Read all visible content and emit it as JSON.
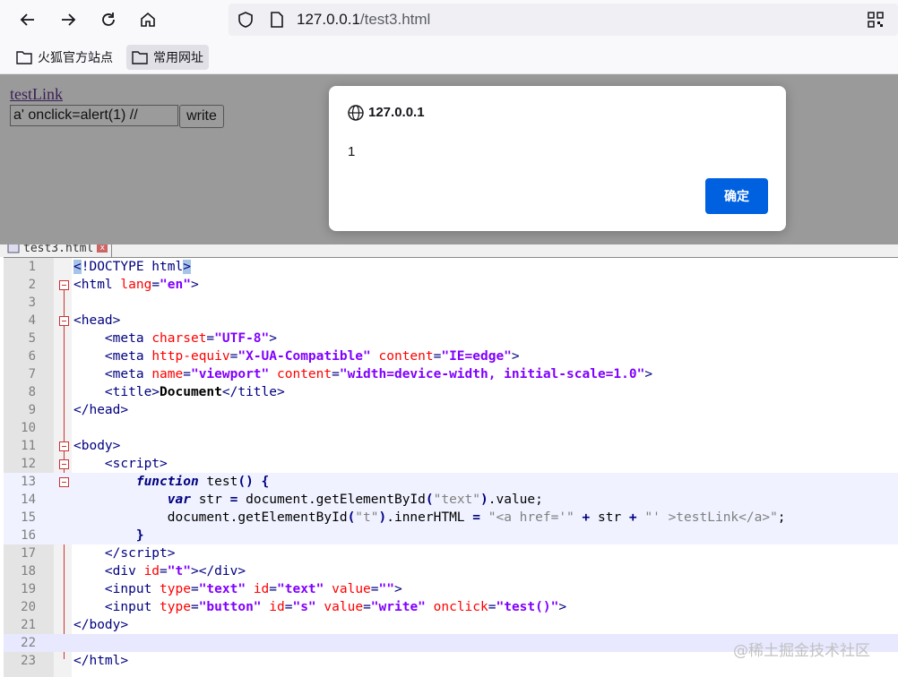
{
  "browser": {
    "url_host": "127.0.0.1",
    "url_path": "/test3.html",
    "bookmarks": [
      {
        "label": "火狐官方站点",
        "icon": "folder-icon"
      },
      {
        "label": "常用网址",
        "icon": "folder-icon"
      }
    ]
  },
  "page": {
    "link_text": "testLink",
    "input_value": "a' onclick=alert(1) //",
    "button_label": "write"
  },
  "dialog": {
    "title": "127.0.0.1",
    "message": "1",
    "ok_label": "确定"
  },
  "editor": {
    "tab_label": "test3.html",
    "line_numbers": [
      "1",
      "2",
      "3",
      "4",
      "5",
      "6",
      "7",
      "8",
      "9",
      "10",
      "11",
      "12",
      "13",
      "14",
      "15",
      "16",
      "17",
      "18",
      "19",
      "20",
      "21",
      "22",
      "23"
    ]
  },
  "watermark": "@稀土掘金技术社区",
  "colors": {
    "accent": "#0061e0",
    "dim_overlay": "#9a9a9a"
  }
}
